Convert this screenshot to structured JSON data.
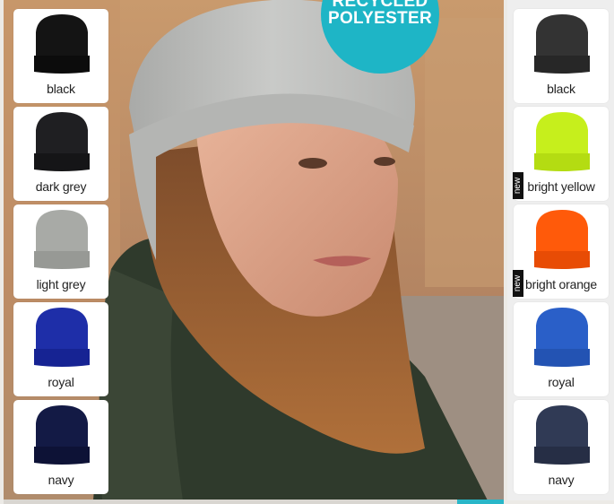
{
  "badge": {
    "line1": "RECYCLED",
    "line2": "POLYESTER",
    "color": "#1eb5c6"
  },
  "left_swatches": [
    {
      "label": "black",
      "hat_color": "#141414",
      "band_color": "#0c0c0c",
      "is_new": false
    },
    {
      "label": "dark grey",
      "hat_color": "#1f1f22",
      "band_color": "#151517",
      "is_new": false
    },
    {
      "label": "light grey",
      "hat_color": "#a8aaa6",
      "band_color": "#979995",
      "is_new": false
    },
    {
      "label": "royal",
      "hat_color": "#1e2ea8",
      "band_color": "#162393",
      "is_new": false
    },
    {
      "label": "navy",
      "hat_color": "#131a45",
      "band_color": "#0d1236",
      "is_new": false
    }
  ],
  "right_swatches": [
    {
      "label": "black",
      "hat_color": "#333333",
      "band_color": "#272727",
      "is_new": false
    },
    {
      "label": "bright yellow",
      "hat_color": "#c6ef1c",
      "band_color": "#b4dc12",
      "is_new": true
    },
    {
      "label": "bright orange",
      "hat_color": "#ff5a0a",
      "band_color": "#e84c05",
      "is_new": true
    },
    {
      "label": "royal",
      "hat_color": "#2a5fc8",
      "band_color": "#2353b3",
      "is_new": false
    },
    {
      "label": "navy",
      "hat_color": "#303a55",
      "band_color": "#262e45",
      "is_new": false
    }
  ],
  "new_tag_text": "new"
}
